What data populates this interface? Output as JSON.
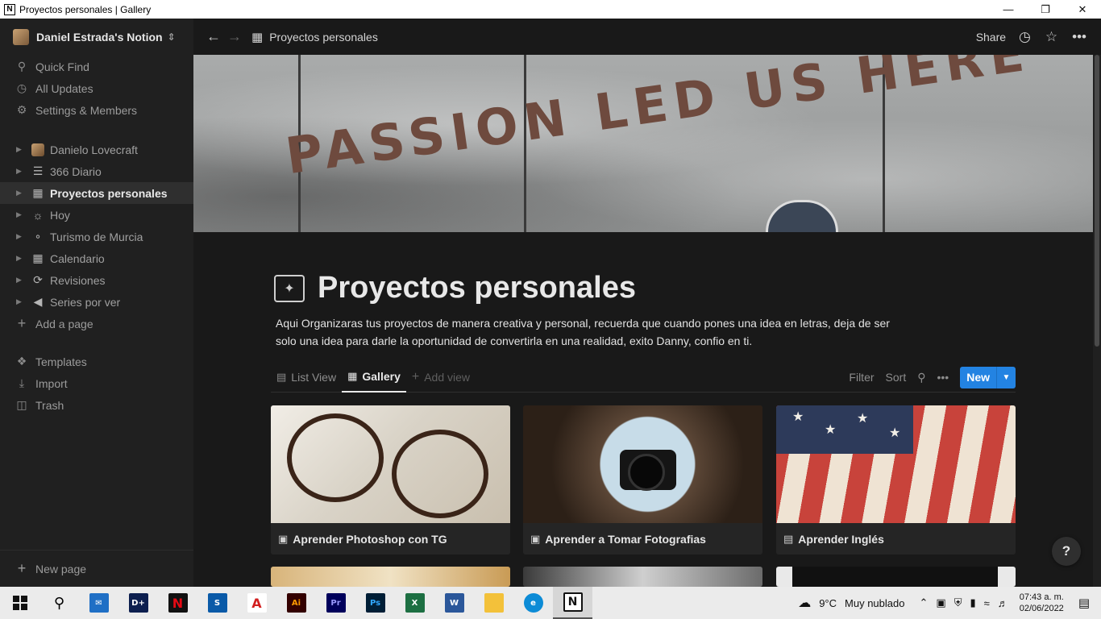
{
  "window": {
    "title": "Proyectos personales | Gallery",
    "app_icon": "N"
  },
  "sidebar": {
    "workspace": "Daniel Estrada's Notion",
    "top_items": [
      {
        "label": "Quick Find",
        "icon": "search-icon"
      },
      {
        "label": "All Updates",
        "icon": "clock-icon"
      },
      {
        "label": "Settings & Members",
        "icon": "gear-icon"
      }
    ],
    "pages": [
      {
        "label": "Danielo Lovecraft"
      },
      {
        "label": "366 Diario"
      },
      {
        "label": "Proyectos personales",
        "active": true
      },
      {
        "label": "Hoy"
      },
      {
        "label": "Turismo de Murcia"
      },
      {
        "label": "Calendario"
      },
      {
        "label": "Revisiones"
      },
      {
        "label": "Series por ver"
      }
    ],
    "add_page": "Add a page",
    "bottom_items": [
      {
        "label": "Templates"
      },
      {
        "label": "Import"
      },
      {
        "label": "Trash"
      }
    ],
    "new_page": "New page"
  },
  "topbar": {
    "breadcrumb": "Proyectos personales",
    "share": "Share"
  },
  "cover": {
    "text": "PASSION LED US HERE"
  },
  "page": {
    "title": "Proyectos personales",
    "description_line1": "Aqui Organizaras tus proyectos de manera creativa y personal, recuerda que cuando pones una idea en letras, deja de ser",
    "description_line2": "solo una idea para darle la oportunidad de convertirla en una realidad, exito Danny, confio en ti."
  },
  "views": {
    "tabs": [
      {
        "label": "List View",
        "active": false
      },
      {
        "label": "Gallery",
        "active": true
      }
    ],
    "add_view": "Add view",
    "filter": "Filter",
    "sort": "Sort",
    "new": "New"
  },
  "gallery": [
    {
      "title": "Aprender Photoshop con TG"
    },
    {
      "title": "Aprender a Tomar Fotografias"
    },
    {
      "title": "Aprender Inglés"
    }
  ],
  "help": "?",
  "taskbar": {
    "weather_temp": "9°C",
    "weather_desc": "Muy nublado",
    "time": "07:43 a. m.",
    "date": "02/06/2022"
  },
  "colors": {
    "accent": "#2383e2",
    "background": "#191919",
    "sidebar": "#202020"
  }
}
